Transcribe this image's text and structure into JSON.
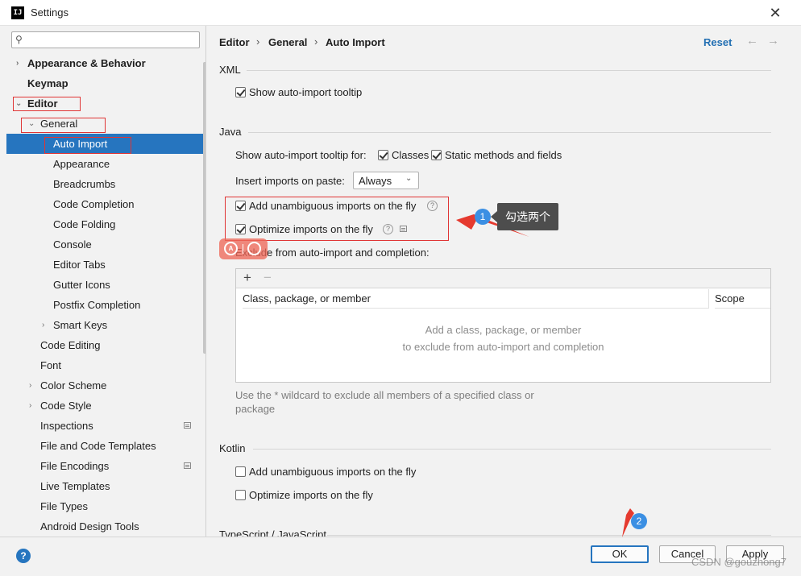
{
  "window": {
    "title": "Settings",
    "app_icon_text": "IJ",
    "close_glyph": "✕"
  },
  "sidebar": {
    "search_placeholder": "",
    "items": [
      {
        "label": "Appearance & Behavior",
        "level": 0,
        "bold": true,
        "arrow": "›"
      },
      {
        "label": "Keymap",
        "level": 0,
        "bold": true
      },
      {
        "label": "Editor",
        "level": 0,
        "bold": true,
        "arrow": "⌄"
      },
      {
        "label": "General",
        "level": 1,
        "arrow": "⌄"
      },
      {
        "label": "Auto Import",
        "level": 2,
        "selected": true
      },
      {
        "label": "Appearance",
        "level": 2
      },
      {
        "label": "Breadcrumbs",
        "level": 2
      },
      {
        "label": "Code Completion",
        "level": 2
      },
      {
        "label": "Code Folding",
        "level": 2
      },
      {
        "label": "Console",
        "level": 2
      },
      {
        "label": "Editor Tabs",
        "level": 2
      },
      {
        "label": "Gutter Icons",
        "level": 2
      },
      {
        "label": "Postfix Completion",
        "level": 2
      },
      {
        "label": "Smart Keys",
        "level": 2,
        "arrow": "›"
      },
      {
        "label": "Code Editing",
        "level": 1
      },
      {
        "label": "Font",
        "level": 1
      },
      {
        "label": "Color Scheme",
        "level": 1,
        "arrow": "›"
      },
      {
        "label": "Code Style",
        "level": 1,
        "arrow": "›"
      },
      {
        "label": "Inspections",
        "level": 1,
        "settings_icon": true
      },
      {
        "label": "File and Code Templates",
        "level": 1
      },
      {
        "label": "File Encodings",
        "level": 1,
        "settings_icon": true
      },
      {
        "label": "Live Templates",
        "level": 1
      },
      {
        "label": "File Types",
        "level": 1
      },
      {
        "label": "Android Design Tools",
        "level": 1
      }
    ]
  },
  "content": {
    "breadcrumb": [
      "Editor",
      "General",
      "Auto Import"
    ],
    "breadcrumb_sep": "›",
    "reset_label": "Reset",
    "back_glyph": "←",
    "forward_glyph": "→",
    "xml": {
      "title": "XML",
      "show_tooltip": {
        "label": "Show auto-import tooltip",
        "checked": true
      }
    },
    "java": {
      "title": "Java",
      "tooltip_for_label": "Show auto-import tooltip for:",
      "classes": {
        "label": "Classes",
        "checked": true
      },
      "static_methods": {
        "label": "Static methods and fields",
        "checked": true
      },
      "insert_on_paste_label": "Insert imports on paste:",
      "insert_on_paste_value": "Always",
      "add_unambiguous": {
        "label": "Add unambiguous imports on the fly",
        "checked": true
      },
      "optimize_imports": {
        "label": "Optimize imports on the fly",
        "checked": true
      },
      "exclude_label": "Exclude from auto-import and completion:",
      "table": {
        "add_glyph": "+",
        "remove_glyph": "−",
        "columns": [
          "Class, package, or member",
          "Scope"
        ],
        "empty_line1": "Add a class, package, or member",
        "empty_line2": "to exclude from auto-import and completion"
      },
      "hint_line1": "Use the * wildcard to exclude all members of a specified class or",
      "hint_line2": "package"
    },
    "kotlin": {
      "title": "Kotlin",
      "add_unambiguous": {
        "label": "Add unambiguous imports on the fly",
        "checked": false
      },
      "optimize_imports": {
        "label": "Optimize imports on the fly",
        "checked": false
      }
    },
    "ts": {
      "title": "TypeScript / JavaScript"
    },
    "help_glyph": "?"
  },
  "footer": {
    "help_glyph": "?",
    "ok_label": "OK",
    "cancel_label": "Cancel",
    "apply_label": "Apply"
  },
  "annotations": {
    "badge1": "1",
    "badge2": "2",
    "note_text": "勾选两个",
    "watermark": "CSDN @gouzhong7",
    "arrow_color": "#e53a2f"
  }
}
